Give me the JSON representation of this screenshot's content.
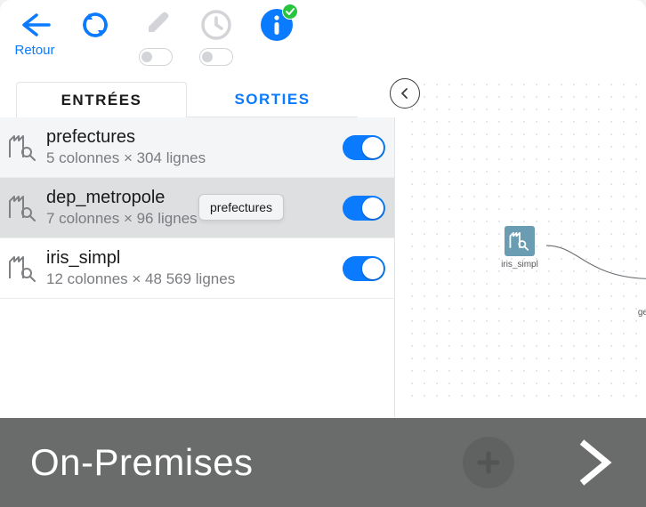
{
  "toolbar": {
    "back_label": "Retour"
  },
  "tabs": {
    "entries": "ENTRÉES",
    "sorties": "SORTIES"
  },
  "rows": [
    {
      "title": "prefectures",
      "subtitle": "5 colonnes × 304 lignes"
    },
    {
      "title": "dep_metropole",
      "subtitle": "7 colonnes × 96 lignes"
    },
    {
      "title": "iris_simpl",
      "subtitle": "12 colonnes × 48 569 lignes"
    }
  ],
  "tooltip": "prefectures",
  "canvas": {
    "node_label": "iris_simpl",
    "edge_label": "ge"
  },
  "footer": {
    "title": "On-Premises"
  },
  "colors": {
    "accent": "#0a7aff",
    "footer_bg": "#6a6b6b",
    "node_bg": "#6a9db2"
  }
}
